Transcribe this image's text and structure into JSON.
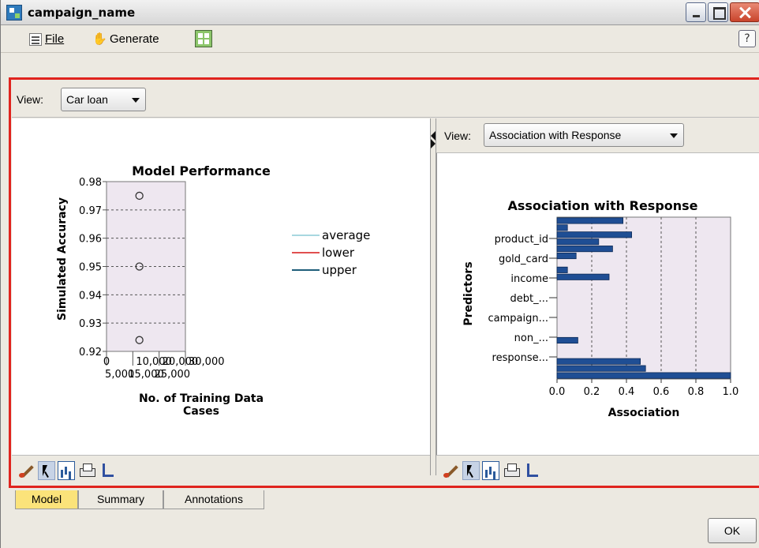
{
  "window": {
    "title": "campaign_name"
  },
  "menubar": {
    "file_label": "File",
    "generate_label": "Generate"
  },
  "view_row": {
    "view_label": "View:",
    "view_value": "Car loan"
  },
  "right_view": {
    "view_label": "View:",
    "view_value": "Association with Response"
  },
  "tabs": {
    "model": "Model",
    "summary": "Summary",
    "annotations": "Annotations"
  },
  "footer": {
    "ok_label": "OK"
  },
  "colors": {
    "frame_red": "#e0241e",
    "plot_background": "#eee7f0",
    "bar_fill": "#1f4e94",
    "legend_average": "#a8d8e0",
    "legend_lower": "#e05050",
    "legend_upper": "#1f5e7a"
  },
  "chart_data": [
    {
      "type": "scatter",
      "title": "Model Performance",
      "xlabel": "No. of Training Data Cases",
      "xlabel_lines": [
        "No. of Training Data",
        "Cases"
      ],
      "ylabel": "Simulated Accuracy",
      "xlim": [
        0,
        30000
      ],
      "ylim": [
        0.92,
        0.98
      ],
      "x_ticks_top": [
        "0",
        "10,000",
        "20,000",
        "30,000"
      ],
      "x_ticks_bottom": [
        "5,000",
        "15,000",
        "25,000"
      ],
      "y_ticks": [
        "0.92",
        "0.93",
        "0.94",
        "0.95",
        "0.96",
        "0.97",
        "0.98"
      ],
      "y_tick_values": [
        0.92,
        0.93,
        0.94,
        0.95,
        0.96,
        0.97,
        0.98
      ],
      "grid": true,
      "legend_position": "right",
      "series": [
        {
          "name": "average",
          "x": [
            12500
          ],
          "y": [
            0.95
          ]
        },
        {
          "name": "lower",
          "x": [
            12500
          ],
          "y": [
            0.924
          ]
        },
        {
          "name": "upper",
          "x": [
            12500
          ],
          "y": [
            0.975
          ]
        }
      ]
    },
    {
      "type": "bar",
      "orientation": "horizontal",
      "title": "Association with Response",
      "xlabel": "Association",
      "ylabel": "Predictors",
      "xlim": [
        0.0,
        1.0
      ],
      "x_ticks": [
        "0.0",
        "0.2",
        "0.4",
        "0.6",
        "0.8",
        "1.0"
      ],
      "y_tick_labels": [
        "product_id",
        "gold_card",
        "income",
        "debt_...",
        "campaign...",
        "non_...",
        "response..."
      ],
      "values": [
        0.38,
        0.06,
        0.43,
        0.24,
        0.32,
        0.11,
        0.0,
        0.06,
        0.3,
        0.0,
        0.0,
        0.0,
        0.0,
        0.0,
        0.0,
        0.0,
        0.0,
        0.12,
        0.0,
        0.0,
        0.48,
        0.51,
        1.0
      ],
      "grid": true
    }
  ]
}
